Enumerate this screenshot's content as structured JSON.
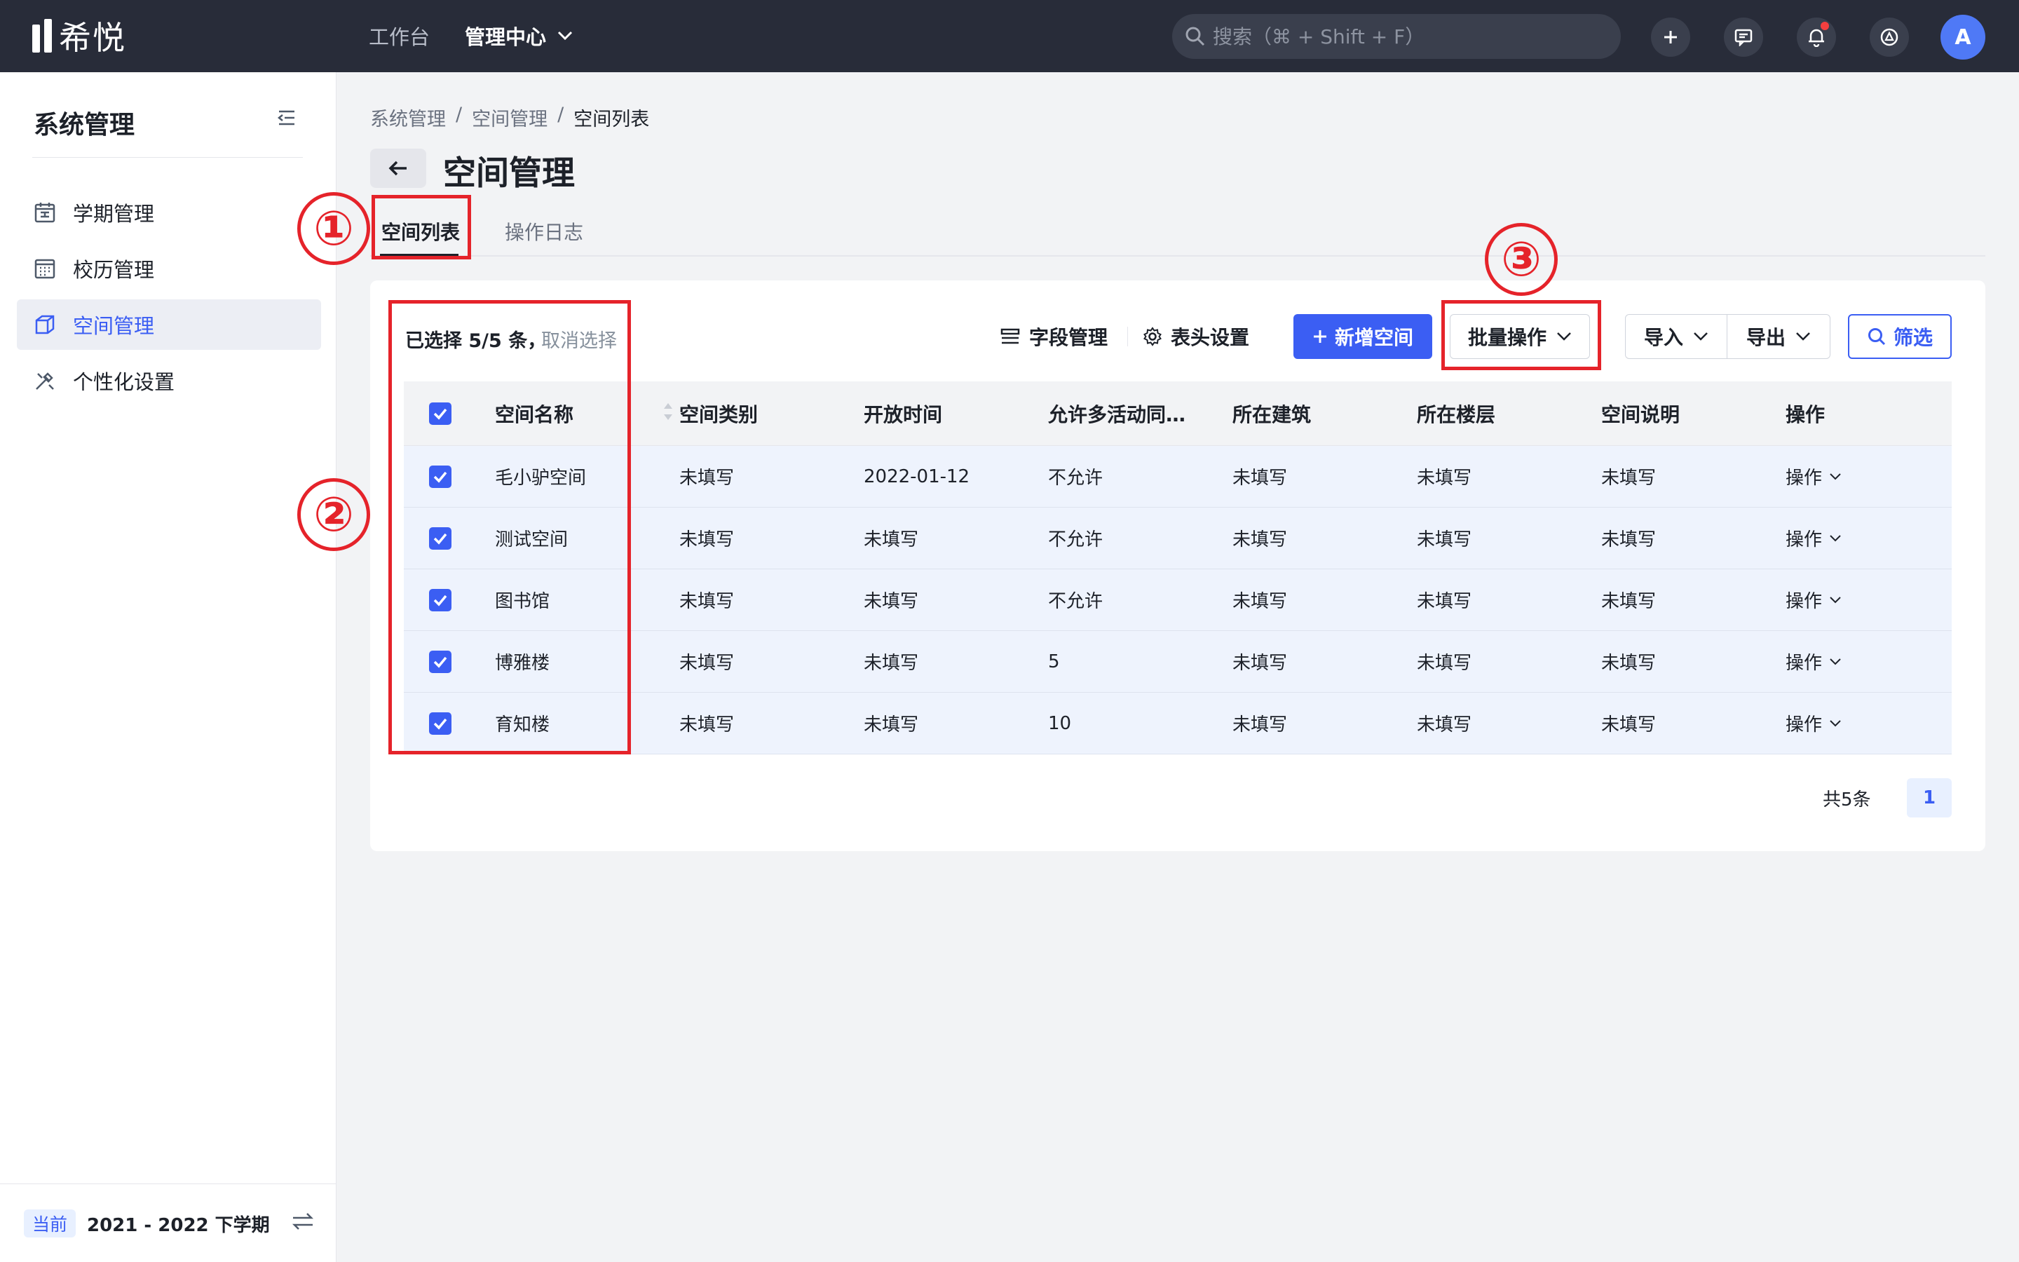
{
  "app": {
    "logo_text": "希悦"
  },
  "topnav": {
    "items": [
      "工作台",
      "管理中心"
    ]
  },
  "search": {
    "placeholder": "搜索（⌘ + Shift + F）"
  },
  "user": {
    "avatar_letter": "A"
  },
  "sidebar": {
    "title": "系统管理",
    "items": [
      {
        "label": "学期管理",
        "icon": "calendar-icon"
      },
      {
        "label": "校历管理",
        "icon": "grid-calendar-icon"
      },
      {
        "label": "空间管理",
        "icon": "cube-icon",
        "active": true
      },
      {
        "label": "个性化设置",
        "icon": "brush-settings-icon"
      }
    ],
    "footer": {
      "badge": "当前",
      "term": "2021 - 2022 下学期"
    }
  },
  "breadcrumb": [
    "系统管理",
    "空间管理",
    "空间列表"
  ],
  "page": {
    "title": "空间管理"
  },
  "tabs": [
    {
      "label": "空间列表",
      "active": true
    },
    {
      "label": "操作日志"
    }
  ],
  "toolbar": {
    "selection": "已选择 5/5 条，",
    "cancel": "取消选择",
    "field_manage": "字段管理",
    "header_settings": "表头设置",
    "add_space": "新增空间",
    "batch": "批量操作",
    "import": "导入",
    "export": "导出",
    "filter": "筛选"
  },
  "table": {
    "columns": [
      "空间名称",
      "空间类别",
      "开放时间",
      "允许多活动同…",
      "所在建筑",
      "所在楼层",
      "空间说明",
      "操作"
    ],
    "rows": [
      [
        "毛小驴空间",
        "未填写",
        "2022-01-12",
        "不允许",
        "未填写",
        "未填写",
        "未填写",
        "操作"
      ],
      [
        "测试空间",
        "未填写",
        "未填写",
        "不允许",
        "未填写",
        "未填写",
        "未填写",
        "操作"
      ],
      [
        "图书馆",
        "未填写",
        "未填写",
        "不允许",
        "未填写",
        "未填写",
        "未填写",
        "操作"
      ],
      [
        "博雅楼",
        "未填写",
        "未填写",
        "5",
        "未填写",
        "未填写",
        "未填写",
        "操作"
      ],
      [
        "育知楼",
        "未填写",
        "未填写",
        "10",
        "未填写",
        "未填写",
        "未填写",
        "操作"
      ]
    ]
  },
  "pagination": {
    "total": "共5条",
    "current": "1"
  },
  "annotations": [
    "①",
    "②",
    "③"
  ],
  "colors": {
    "primary": "#3b5ef3",
    "topbar": "#282c39",
    "annotation": "#e5232a"
  }
}
